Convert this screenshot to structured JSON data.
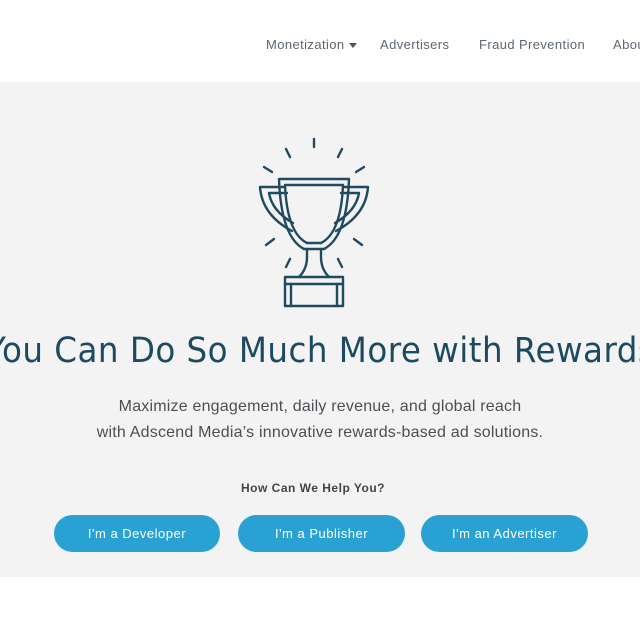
{
  "nav": {
    "items": [
      "Monetization",
      "Advertisers",
      "Fraud Prevention",
      "About"
    ]
  },
  "hero": {
    "icon": "trophy-icon",
    "headline": "You Can Do So Much More with Rewards",
    "subtext_line1": "Maximize engagement, daily revenue, and global reach",
    "subtext_line2": "with Adscend Media’s innovative rewards-based ad solutions.",
    "help_label": "How Can We Help You?",
    "buttons": [
      "I'm a Developer",
      "I'm a Publisher",
      "I'm an Advertiser"
    ]
  },
  "colors": {
    "accent": "#2aa1d3",
    "headline": "#1d4a5e",
    "hero_background": "#f3f3f3",
    "trophy_stroke": "#1f4a5f"
  }
}
